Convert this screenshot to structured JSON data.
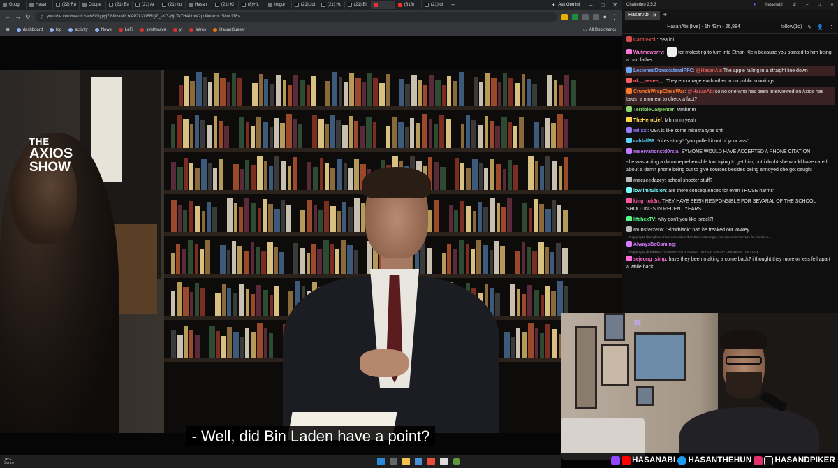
{
  "browser": {
    "tabs": [
      "Googl",
      "Hasan",
      "(22) Ru",
      "Coope",
      "(21) Bu",
      "(21) Ar",
      "(21) hu",
      "Hasan",
      "(21) Ki",
      "(8)+|L",
      "Imgur",
      "(21) Jol",
      "(21) Ho",
      "(21) Bl",
      "",
      "(318)",
      "(21) dr"
    ],
    "gemini_label": "Ask Gemini",
    "url": "youtube.com/watch?v=h8VfIypyj7l8&list=PLKAP7kXOFRQ7_sKG-j9jLTaTHALbxA2pt&index=15&t=176s",
    "bookmarks": [
      "dashboard",
      "top",
      "activity",
      "News",
      "LoFi",
      "synthwave",
      "yt",
      "intros",
      "HasanGuessr"
    ],
    "all_bookmarks": "All Bookmarks"
  },
  "video": {
    "show_logo": {
      "line1": "THE",
      "line2": "AXIOS",
      "line3": "SHOW"
    },
    "caption": "- Well, did Bin Laden have a point?"
  },
  "taskbar": {
    "temp": "76°F",
    "condition": "Sunny"
  },
  "chatterino": {
    "app_title": "Chatterino 2.5.3",
    "user": "hasanabi",
    "tab": "HasanAbi",
    "channel_header": "HasanAbi (live) - 1h 43m - 26,884",
    "follow_label": "follow(1d)",
    "messages": [
      {
        "user": "Cathtexcil",
        "text": "Yea lol",
        "color": "#d84b4b",
        "hl": false
      },
      {
        "user": "Wutmeworry",
        "text": "for molesting to turn into Ethan Klein because you pointed to him being a bad father",
        "color": "#ff7ad9",
        "hl": false,
        "emote": "w"
      },
      {
        "user": "LesionedDorsolateralPFC",
        "mention": "@HasanAbi",
        "text": "The apple falling in a straight line down",
        "color": "#6fa8ff",
        "hl": true
      },
      {
        "user": "ok__eevee__",
        "text": "They encourage each other to do public scootings",
        "color": "#ff6060",
        "hl": false
      },
      {
        "user": "CrunchWrapClassWar",
        "mention": "@HasanAbi",
        "text": "so no one who has been interviewed on Axios has taken a moment to check a fact?",
        "color": "#ff7a2a",
        "hl": true
      },
      {
        "user": "TerribleCarpenter",
        "text": "Mmhmm",
        "color": "#8ad86a",
        "hl": false
      },
      {
        "user": "TheHeroLief",
        "text": "Mhmmm yeah",
        "color": "#ffd84a",
        "hl": false
      },
      {
        "user": "relixxi",
        "text": "O9A is like some mkultra type shit",
        "color": "#9a7aff",
        "hl": false
      },
      {
        "user": "caldalf69",
        "text": "*cites study* \"you pulled it out of your ass\"",
        "color": "#5ad6ff",
        "hl": false
      },
      {
        "user": "reservationstd0rsia",
        "text": "SYMONE WOULD HAVE ACCEPTED A PHONE CITATION",
        "color": "#c77aff",
        "hl": false
      },
      {
        "user": "",
        "text": "she was acting a damn reprehensible fool trying to get him, but i doubt she would have cared about a damn phone being out to give sources besides being annoyed she got caught",
        "color": "#e6e6e6",
        "hl": false
      },
      {
        "user": "maezeedazey",
        "text": "school shooter stuff?",
        "color": "#bbbbbb",
        "hl": false
      },
      {
        "user": "lowlimitvision",
        "text": "are there consequences for even THOSE harms\"",
        "color": "#7affff",
        "hl": false
      },
      {
        "user": "king_tok3n",
        "text": "THEY HAVE BEEN RESPONSIBLE FOR SEVARAL OF THE SCHOOL SHOOTINGS IN RECENT YEARS",
        "color": "#ff5aa0",
        "hl": false
      },
      {
        "user": "lifehexTV",
        "text": "why don't you like israel?!",
        "color": "#5aff8a",
        "hl": false
      },
      {
        "user": "munsterzero",
        "text": "\"Blowblack\" nah he freaked out lowkey",
        "color": "#bbbbbb",
        "hl": false
      },
      {
        "reply": "Replying to @wegbone: I'm a new subscriber! Been listening to your takes on YouTube for months a...",
        "user": "AlwaysBeGaming",
        "text": "",
        "color": "#d77aff",
        "hl": false
      },
      {
        "reply": "Replying to @redshoot: ATOMWAFEN IS ALSO A TERROR GROUP LIKE WHAT THE FUCK",
        "user": "sejeong_simp",
        "text": "have they been making a come back? i thought they more or less fell apart a while back",
        "color": "#ff6bd9",
        "hl": false
      }
    ]
  },
  "socials": [
    "HASANABI",
    "HASANTHEHUN",
    "HASANDPIKER"
  ],
  "colors": {
    "twitch": "#9146ff",
    "youtube": "#ff0000",
    "twitter": "#1d9bf0",
    "instagram": "#e1306c"
  }
}
